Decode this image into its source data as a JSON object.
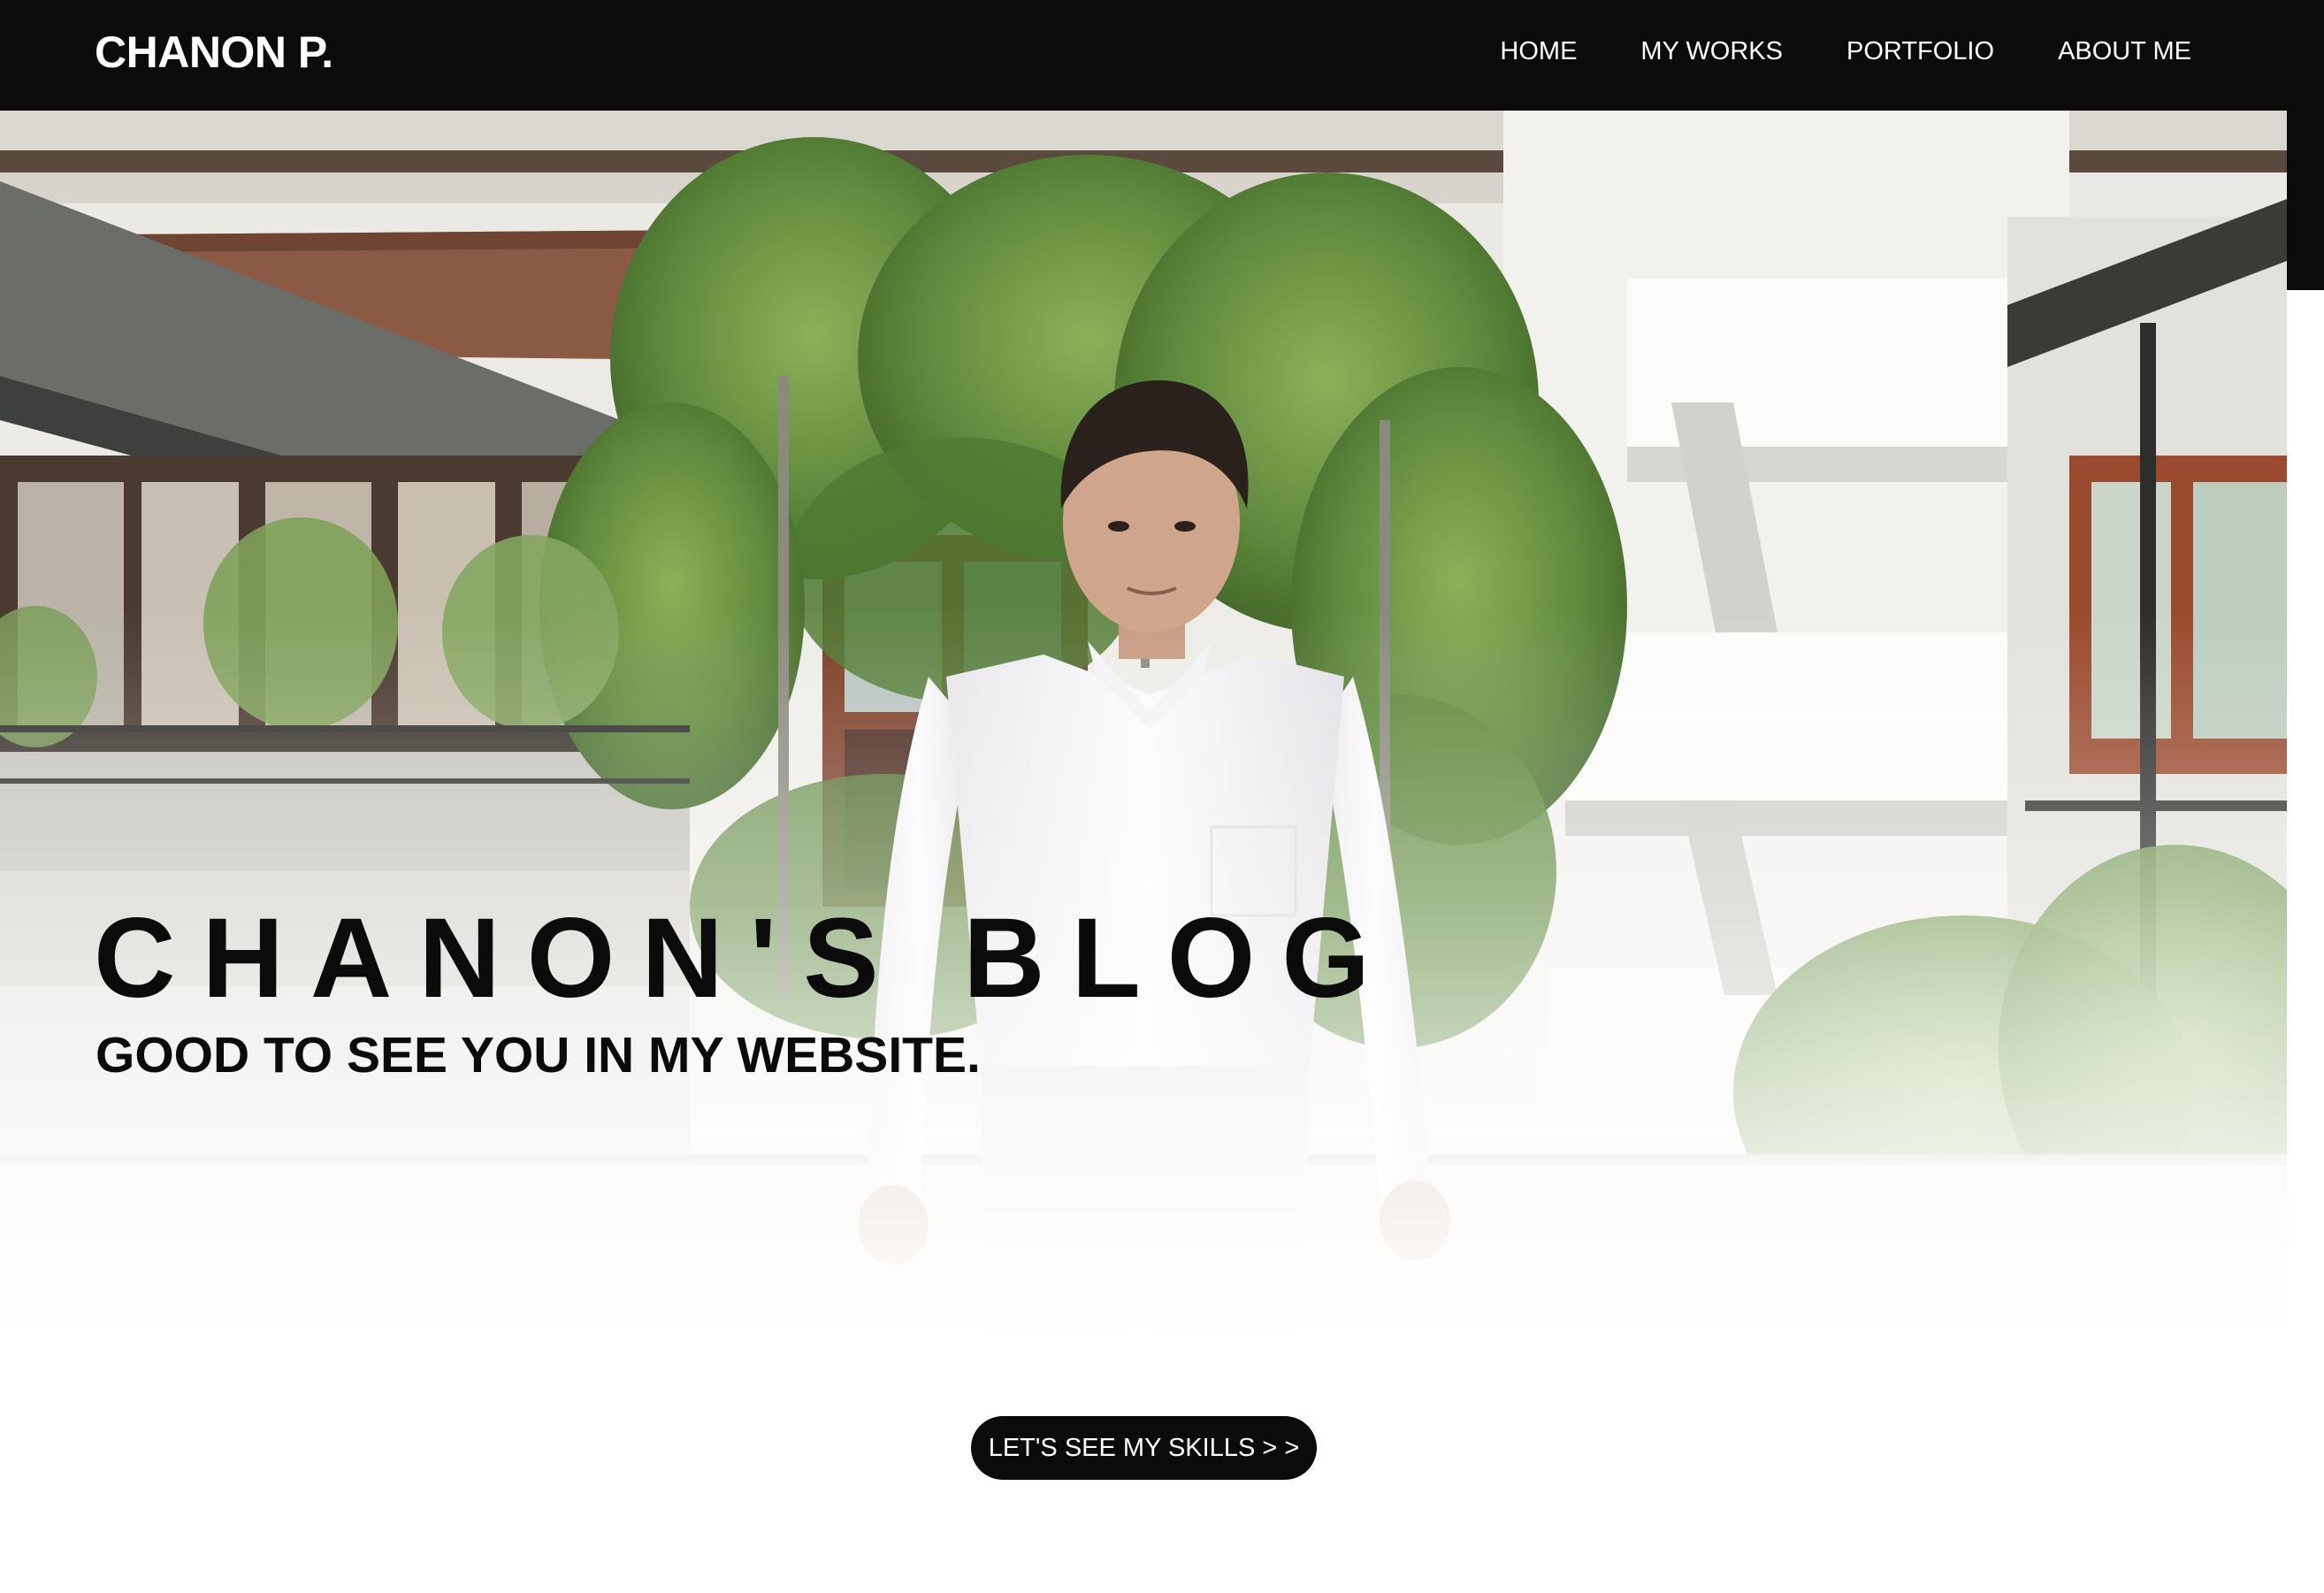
{
  "navbar": {
    "brand": "CHANON P.",
    "links": [
      {
        "label": "HOME"
      },
      {
        "label": "MY WORKS"
      },
      {
        "label": "PORTFOLIO"
      },
      {
        "label": "ABOUT ME"
      }
    ]
  },
  "hero": {
    "title": "CHANON'S BLOG",
    "subtitle": "GOOD TO SEE YOU IN MY WEBSITE.",
    "cta_label": "LET'S SEE MY SKILLS > >"
  },
  "colors": {
    "navbar_bg": "#0b0b0b",
    "text_dark": "#0b0b0b",
    "page_bg": "#ffffff",
    "foliage": "#5f8a3c",
    "building": "#ecebe6"
  }
}
